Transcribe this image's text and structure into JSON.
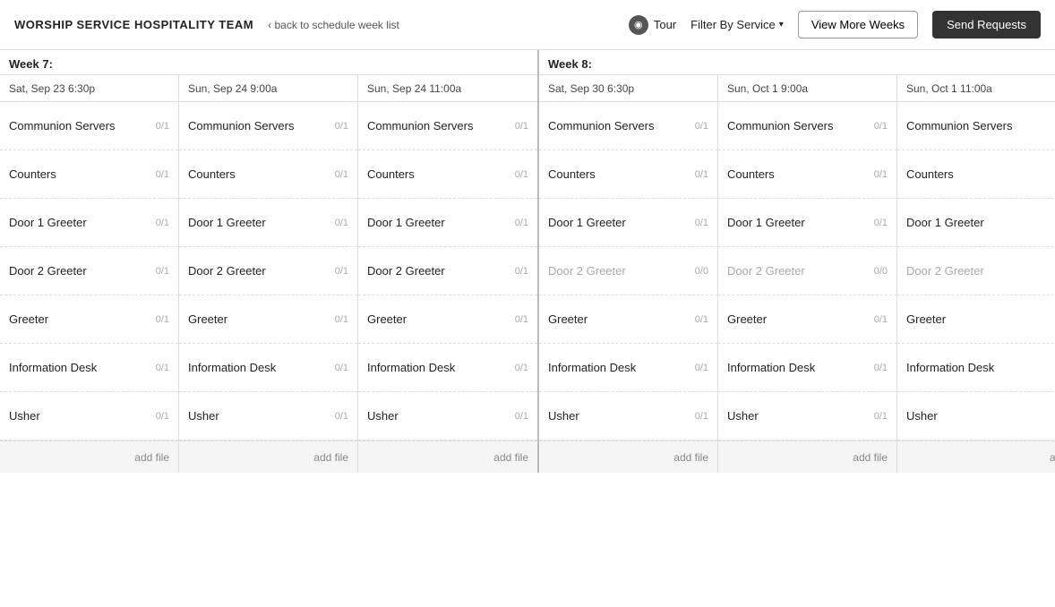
{
  "header": {
    "title": "WORSHIP SERVICE HOSPITALITY TEAM",
    "back_label": "back to schedule week list",
    "tour_label": "Tour",
    "tour_icon": "◉",
    "filter_label": "Filter By Service",
    "view_more_label": "View More Weeks",
    "send_requests_label": "Send Requests"
  },
  "weeks": [
    {
      "id": "week7",
      "label": "Week 7:",
      "columns": [
        {
          "date": "Sat, Sep 23 6:30p",
          "roles": [
            {
              "name": "Communion Servers",
              "count": "0/1",
              "greyed": false
            },
            {
              "name": "Counters",
              "count": "0/1",
              "greyed": false
            },
            {
              "name": "Door 1 Greeter",
              "count": "0/1",
              "greyed": false
            },
            {
              "name": "Door 2 Greeter",
              "count": "0/1",
              "greyed": false
            },
            {
              "name": "Greeter",
              "count": "0/1",
              "greyed": false
            },
            {
              "name": "Information Desk",
              "count": "0/1",
              "greyed": false
            },
            {
              "name": "Usher",
              "count": "0/1",
              "greyed": false
            }
          ],
          "add_file": "add file"
        },
        {
          "date": "Sun, Sep 24 9:00a",
          "roles": [
            {
              "name": "Communion Servers",
              "count": "0/1",
              "greyed": false
            },
            {
              "name": "Counters",
              "count": "0/1",
              "greyed": false
            },
            {
              "name": "Door 1 Greeter",
              "count": "0/1",
              "greyed": false
            },
            {
              "name": "Door 2 Greeter",
              "count": "0/1",
              "greyed": false
            },
            {
              "name": "Greeter",
              "count": "0/1",
              "greyed": false
            },
            {
              "name": "Information Desk",
              "count": "0/1",
              "greyed": false
            },
            {
              "name": "Usher",
              "count": "0/1",
              "greyed": false
            }
          ],
          "add_file": "add file"
        },
        {
          "date": "Sun, Sep 24 11:00a",
          "roles": [
            {
              "name": "Communion Servers",
              "count": "0/1",
              "greyed": false
            },
            {
              "name": "Counters",
              "count": "0/1",
              "greyed": false
            },
            {
              "name": "Door 1 Greeter",
              "count": "0/1",
              "greyed": false
            },
            {
              "name": "Door 2 Greeter",
              "count": "0/1",
              "greyed": false
            },
            {
              "name": "Greeter",
              "count": "0/1",
              "greyed": false
            },
            {
              "name": "Information Desk",
              "count": "0/1",
              "greyed": false
            },
            {
              "name": "Usher",
              "count": "0/1",
              "greyed": false
            }
          ],
          "add_file": "add file"
        }
      ]
    },
    {
      "id": "week8",
      "label": "Week 8:",
      "columns": [
        {
          "date": "Sat, Sep 30 6:30p",
          "roles": [
            {
              "name": "Communion Servers",
              "count": "0/1",
              "greyed": false
            },
            {
              "name": "Counters",
              "count": "0/1",
              "greyed": false
            },
            {
              "name": "Door 1 Greeter",
              "count": "0/1",
              "greyed": false
            },
            {
              "name": "Door 2 Greeter",
              "count": "0/0",
              "greyed": true
            },
            {
              "name": "Greeter",
              "count": "0/1",
              "greyed": false
            },
            {
              "name": "Information Desk",
              "count": "0/1",
              "greyed": false
            },
            {
              "name": "Usher",
              "count": "0/1",
              "greyed": false
            }
          ],
          "add_file": "add file"
        },
        {
          "date": "Sun, Oct 1 9:00a",
          "roles": [
            {
              "name": "Communion Servers",
              "count": "0/1",
              "greyed": false
            },
            {
              "name": "Counters",
              "count": "0/1",
              "greyed": false
            },
            {
              "name": "Door 1 Greeter",
              "count": "0/1",
              "greyed": false
            },
            {
              "name": "Door 2 Greeter",
              "count": "0/0",
              "greyed": true
            },
            {
              "name": "Greeter",
              "count": "0/1",
              "greyed": false
            },
            {
              "name": "Information Desk",
              "count": "0/1",
              "greyed": false
            },
            {
              "name": "Usher",
              "count": "0/1",
              "greyed": false
            }
          ],
          "add_file": "add file"
        },
        {
          "date": "Sun, Oct 1 11:00a",
          "roles": [
            {
              "name": "Communion Servers",
              "count": "",
              "greyed": false
            },
            {
              "name": "Counters",
              "count": "",
              "greyed": false
            },
            {
              "name": "Door 1 Greeter",
              "count": "",
              "greyed": false
            },
            {
              "name": "Door 2 Greeter",
              "count": "",
              "greyed": true
            },
            {
              "name": "Greeter",
              "count": "",
              "greyed": false
            },
            {
              "name": "Information Desk",
              "count": "",
              "greyed": false
            },
            {
              "name": "Usher",
              "count": "",
              "greyed": false
            }
          ],
          "add_file": "add"
        }
      ]
    }
  ]
}
